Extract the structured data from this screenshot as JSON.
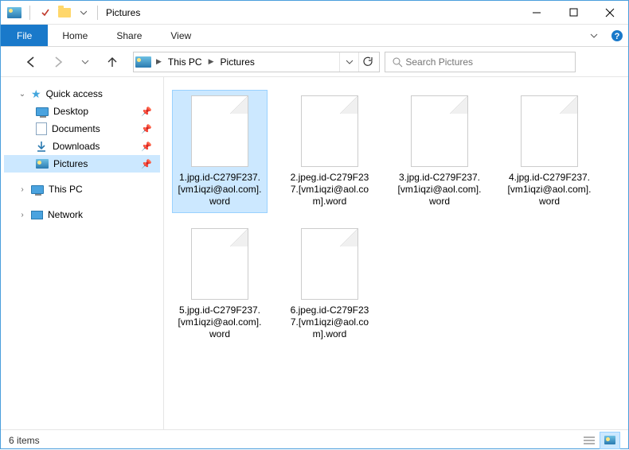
{
  "titlebar": {
    "title": "Pictures"
  },
  "ribbon": {
    "file": "File",
    "tabs": [
      "Home",
      "Share",
      "View"
    ]
  },
  "breadcrumb": {
    "segments": [
      "This PC",
      "Pictures"
    ]
  },
  "search": {
    "placeholder": "Search Pictures"
  },
  "tree": {
    "quick_access": "Quick access",
    "items": [
      {
        "label": "Desktop",
        "icon": "desktop",
        "pinned": true
      },
      {
        "label": "Documents",
        "icon": "document",
        "pinned": true
      },
      {
        "label": "Downloads",
        "icon": "download",
        "pinned": true
      },
      {
        "label": "Pictures",
        "icon": "picture",
        "pinned": true,
        "selected": true
      }
    ],
    "this_pc": "This PC",
    "network": "Network"
  },
  "files": [
    {
      "name": "1.jpg.id-C279F237.[vm1iqzi@aol.com].word",
      "selected": true
    },
    {
      "name": "2.jpeg.id-C279F237.[vm1iqzi@aol.com].word"
    },
    {
      "name": "3.jpg.id-C279F237.[vm1iqzi@aol.com].word"
    },
    {
      "name": "4.jpg.id-C279F237.[vm1iqzi@aol.com].word"
    },
    {
      "name": "5.jpg.id-C279F237.[vm1iqzi@aol.com].word"
    },
    {
      "name": "6.jpeg.id-C279F237.[vm1iqzi@aol.com].word"
    }
  ],
  "statusbar": {
    "count": "6 items"
  }
}
